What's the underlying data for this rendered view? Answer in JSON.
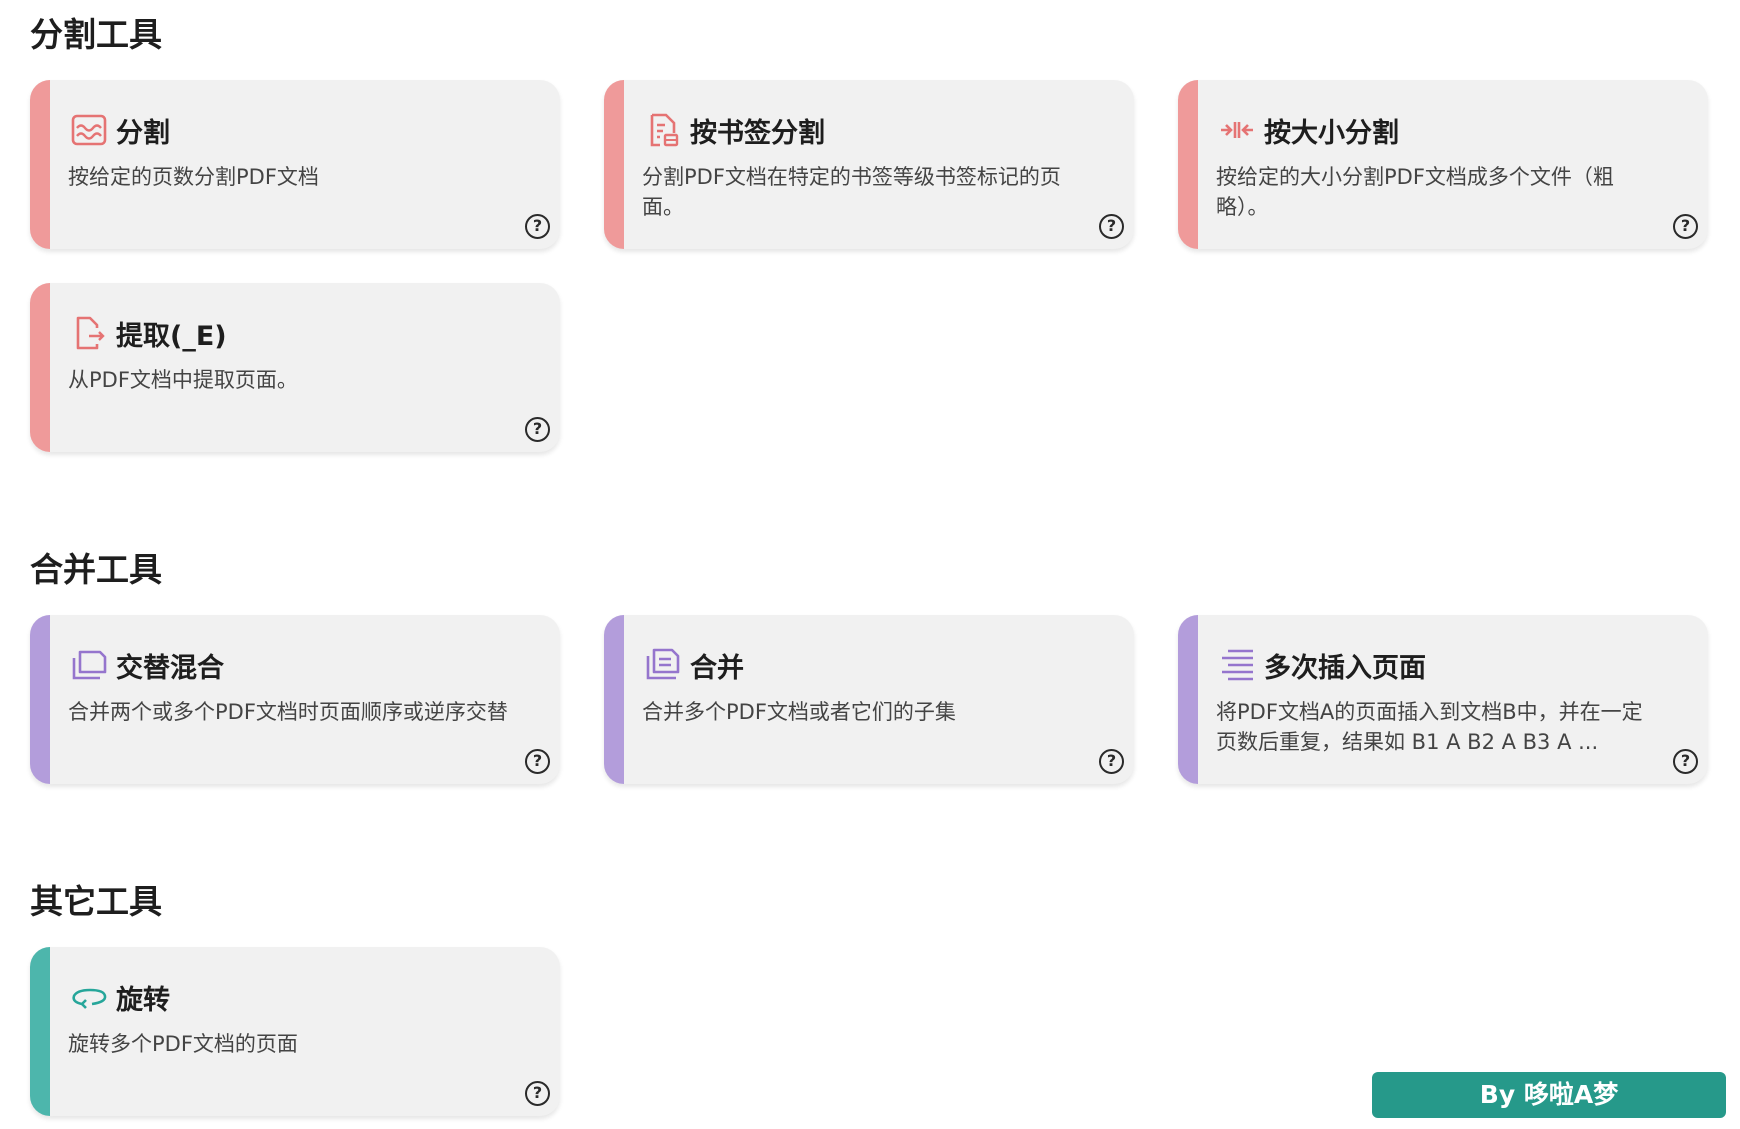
{
  "sections": {
    "split": {
      "title": "分割工具",
      "accent": "#ef9a9a",
      "cards": [
        {
          "icon": "wave-split-icon",
          "title": "分割",
          "desc": "按给定的页数分割PDF文档"
        },
        {
          "icon": "document-bookmark-icon",
          "title": "按书签分割",
          "desc": "分割PDF文档在特定的书签等级书签标记的页面。"
        },
        {
          "icon": "arrows-inward-icon",
          "title": "按大小分割",
          "desc": "按给定的大小分割PDF文档成多个文件（粗略）。"
        },
        {
          "icon": "document-export-icon",
          "title": "提取(_E)",
          "desc": "从PDF文档中提取页面。"
        }
      ]
    },
    "merge": {
      "title": "合并工具",
      "accent": "#b39ddb",
      "cards": [
        {
          "icon": "alternate-pages-icon",
          "title": "交替混合",
          "desc": "合并两个或多个PDF文档时页面顺序或逆序交替"
        },
        {
          "icon": "merge-pages-icon",
          "title": "合并",
          "desc": "合并多个PDF文档或者它们的子集"
        },
        {
          "icon": "insert-lines-icon",
          "title": "多次插入页面",
          "desc": "将PDF文档A的页面插入到文档B中，并在一定页数后重复，结果如 B1 A B2 A B3 A ..."
        }
      ]
    },
    "other": {
      "title": "其它工具",
      "accent": "#4db6ac",
      "cards": [
        {
          "icon": "rotate-icon",
          "title": "旋转",
          "desc": "旋转多个PDF文档的页面"
        }
      ]
    }
  },
  "help_symbol": "?",
  "credit": "By 哆啦A梦",
  "credit_color": "#26998a"
}
